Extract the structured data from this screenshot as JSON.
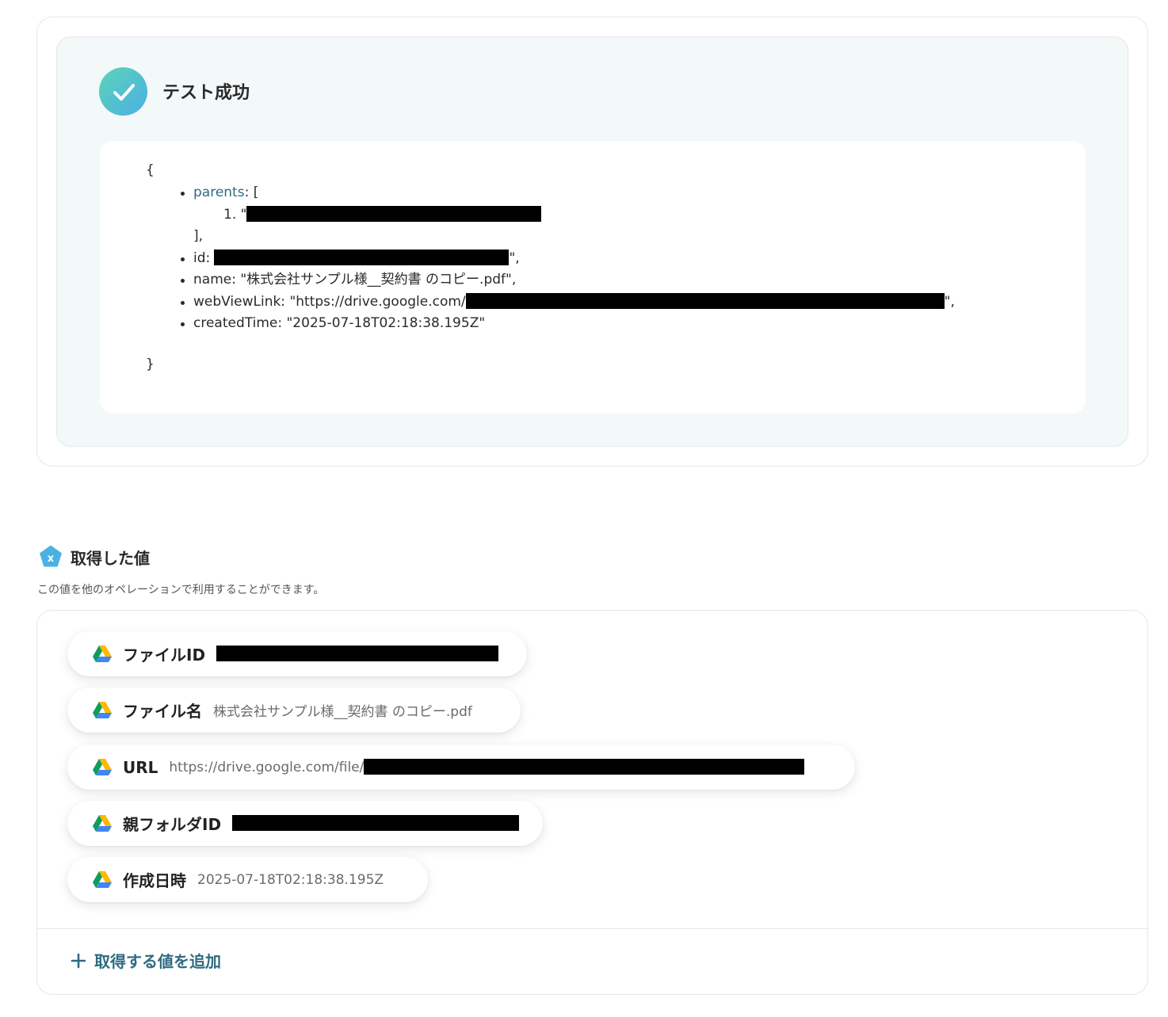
{
  "test_result": {
    "status_title": "テスト成功",
    "json": {
      "open_brace": "{",
      "close_brace": "}",
      "parents_key": "parents",
      "parents_open": ": [",
      "parents_item_prefix": "1. \"",
      "parents_close": "],",
      "id_prefix": "id: \"",
      "id_suffix": "\",",
      "name_line": "name: \"株式会社サンプル様__契約書 のコピー.pdf\",",
      "webview_prefix": "webViewLink: \"https://drive.google.com/",
      "webview_suffix": "\",",
      "created_line": "createdTime: \"2025-07-18T02:18:38.195Z\""
    }
  },
  "acquired": {
    "title": "取得した値",
    "description": "この値を他のオペレーションで利用することができます。",
    "items": [
      {
        "label": "ファイルID",
        "value": ""
      },
      {
        "label": "ファイル名",
        "value": "株式会社サンプル様__契約書 のコピー.pdf"
      },
      {
        "label": "URL",
        "value": "https://drive.google.com/file/"
      },
      {
        "label": "親フォルダID",
        "value": ""
      },
      {
        "label": "作成日時",
        "value": "2025-07-18T02:18:38.195Z"
      }
    ],
    "add_button": "取得する値を追加"
  },
  "icons": {
    "status": "check-icon",
    "acquired": "variable-icon",
    "item": "google-drive-icon",
    "add": "plus-icon"
  },
  "colors": {
    "accent": "#2f6b80",
    "success_gradient_start": "#5cd3b8",
    "success_gradient_end": "#4ab0e4",
    "card_bg": "#f3f8f8"
  }
}
